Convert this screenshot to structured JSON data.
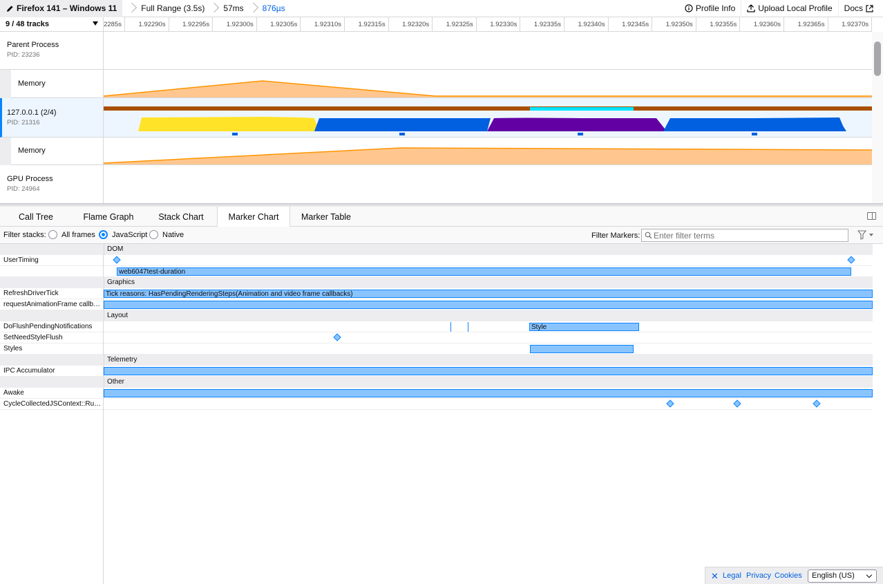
{
  "topbar": {
    "profile_name": "Firefox 141 – Windows 11",
    "breadcrumbs": [
      "Full Range (3.5s)",
      "57ms",
      "876µs"
    ],
    "profile_info": "Profile Info",
    "upload": "Upload Local Profile",
    "docs": "Docs"
  },
  "tracks": {
    "count_label": "9 / 48 tracks",
    "ruler_ticks": [
      "1.92285s",
      "1.92290s",
      "1.92295s",
      "1.92300s",
      "1.92305s",
      "1.92310s",
      "1.92315s",
      "1.92320s",
      "1.92325s",
      "1.92330s",
      "1.92335s",
      "1.92340s",
      "1.92345s",
      "1.92350s",
      "1.92355s",
      "1.92360s",
      "1.92365s",
      "1.92370s"
    ],
    "parent": {
      "name": "Parent Process",
      "pid": "PID: 23236"
    },
    "memory1": {
      "name": "Memory"
    },
    "content": {
      "name": "127.0.0.1 (2/4)",
      "pid": "PID: 21316"
    },
    "memory2": {
      "name": "Memory"
    },
    "gpu": {
      "name": "GPU Process",
      "pid": "PID: 24964"
    }
  },
  "tabs": [
    "Call Tree",
    "Flame Graph",
    "Stack Chart",
    "Marker Chart",
    "Marker Table"
  ],
  "active_tab": "Marker Chart",
  "settings": {
    "filter_stacks_label": "Filter stacks:",
    "options": [
      "All frames",
      "JavaScript",
      "Native"
    ],
    "selected": "JavaScript",
    "filter_markers_label": "Filter Markers:",
    "filter_placeholder": "Enter filter terms"
  },
  "marker_chart": {
    "categories": {
      "dom": "DOM",
      "graphics": "Graphics",
      "layout": "Layout",
      "telemetry": "Telemetry",
      "other": "Other"
    },
    "rows": {
      "usertiming": "UserTiming",
      "usertiming_bar": "web6047test-duration",
      "refreshdriver": "RefreshDriverTick",
      "refreshdriver_bar": "Tick reasons: HasPendingRenderingSteps(Animation and video frame callbacks)",
      "raf": "requestAnimationFrame callb…",
      "doflush": "DoFlushPendingNotifications",
      "doflush_bar": "Style",
      "setneedstyle": "SetNeedStyleFlush",
      "styles": "Styles",
      "ipc": "IPC Accumulator",
      "awake": "Awake",
      "cyclecollected": "CycleCollectedJSContext::Ru…"
    }
  },
  "footer": {
    "legal": "Legal",
    "privacy": "Privacy",
    "cookies": "Cookies",
    "language": "English (US)"
  },
  "colors": {
    "accent": "#0a84ff",
    "marker_fill": "#8ac4ff",
    "memory_fill": "#ffbd7b",
    "memory_line": "#ff9400",
    "cat_js": "#ffe329",
    "cat_layout": "#0060df",
    "cat_gc": "#6200a4"
  }
}
